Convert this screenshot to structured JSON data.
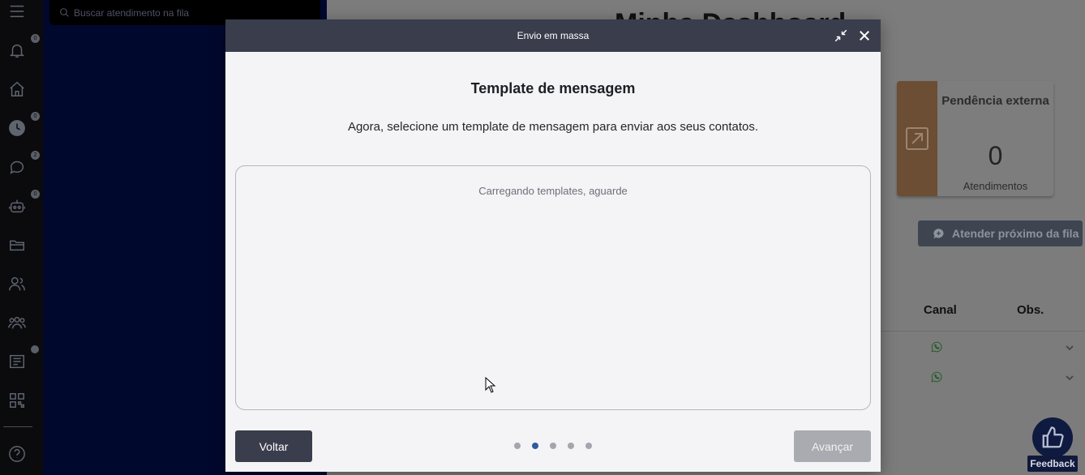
{
  "sidebar": {
    "icons": [
      {
        "name": "menu-icon",
        "badge": ""
      },
      {
        "name": "bell-icon",
        "badge": "0"
      },
      {
        "name": "home-icon",
        "badge": ""
      },
      {
        "name": "clock-icon",
        "badge": "0"
      },
      {
        "name": "chat-icon",
        "badge": "2"
      },
      {
        "name": "bot-icon",
        "badge": "0"
      },
      {
        "name": "folder-icon",
        "badge": ""
      },
      {
        "name": "contacts-icon",
        "badge": ""
      },
      {
        "name": "groups-icon",
        "badge": ""
      },
      {
        "name": "report-icon",
        "badge": ""
      },
      {
        "name": "qrcode-icon",
        "badge": ""
      },
      {
        "name": "help-icon",
        "badge": ""
      }
    ]
  },
  "queue": {
    "search_placeholder": "Buscar atendimento na fila"
  },
  "dashboard": {
    "title": "Minha Dashboard",
    "pending_card": {
      "title": "Pendência externa",
      "count": "0",
      "label": "Atendimentos"
    },
    "next_button_label": "Atender próximo da fila",
    "columns": [
      "Canal",
      "Obs."
    ],
    "feedback_label": "Feedback"
  },
  "modal": {
    "title": "Envio em massa",
    "heading": "Template de mensagem",
    "subtitle": "Agora, selecione um template de mensagem para enviar aos seus contatos.",
    "loading_text": "Carregando templates, aguarde",
    "back_label": "Voltar",
    "next_label": "Avançar",
    "steps_total": 5,
    "current_step": 2
  },
  "colors": {
    "modal_header": "#3a3d4c",
    "active_step": "#2f5aa3",
    "navy_panel": "#00082d"
  }
}
